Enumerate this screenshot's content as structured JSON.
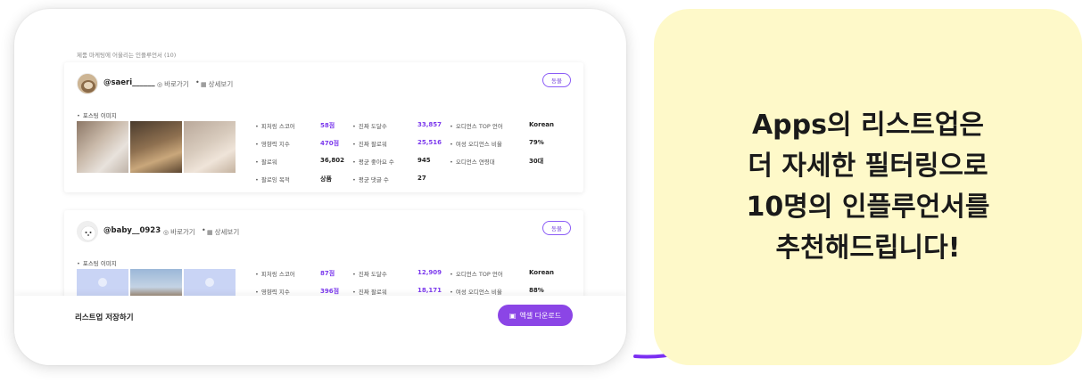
{
  "list": {
    "header": "제품 마케팅에 어울리는 인플루언서 (10)"
  },
  "influencers": [
    {
      "username": "@saeri______",
      "profile_link": "바로가기",
      "detail_link": "상세보기",
      "tag": "동물",
      "posting_label": "포스팅 이미지",
      "metrics": {
        "feature_score": {
          "label": "피처링 스코어",
          "value": "58점"
        },
        "influence_index": {
          "label": "영향력 지수",
          "value": "470점"
        },
        "followers": {
          "label": "팔로워",
          "value": "36,802"
        },
        "follow_purpose": {
          "label": "팔로잉 목적",
          "value": "상품"
        },
        "real_reach": {
          "label": "진짜 도달수",
          "value": "33,857"
        },
        "real_followers": {
          "label": "진짜 팔로워",
          "value": "25,516"
        },
        "avg_likes": {
          "label": "평균 좋아요 수",
          "value": "945"
        },
        "avg_comments": {
          "label": "평균 댓글 수",
          "value": "27"
        },
        "audience_lang": {
          "label": "오디언스 TOP 언어",
          "value": "Korean"
        },
        "female_ratio": {
          "label": "여성 오디언스 비율",
          "value": "79%"
        },
        "age_group": {
          "label": "오디언스 연령대",
          "value": "30대"
        }
      }
    },
    {
      "username": "@baby__0923",
      "profile_link": "바로가기",
      "detail_link": "상세보기",
      "tag": "동물",
      "posting_label": "포스팅 이미지",
      "metrics": {
        "feature_score": {
          "label": "피처링 스코어",
          "value": "87점"
        },
        "influence_index": {
          "label": "영향력 지수",
          "value": "396점"
        },
        "real_reach": {
          "label": "진짜 도달수",
          "value": "12,909"
        },
        "real_followers": {
          "label": "진짜 팔로워",
          "value": "18,171"
        },
        "audience_lang": {
          "label": "오디언스 TOP 언어",
          "value": "Korean"
        },
        "female_ratio": {
          "label": "여성 오디언스 비율",
          "value": "88%"
        }
      }
    }
  ],
  "bottom": {
    "save_label": "리스트업 저장하기",
    "excel_label": "엑셀 다운로드"
  },
  "callout": {
    "lines": [
      "Apps의 리스트업은",
      "더 자세한 필터링으로",
      "10명의 인플루언서를",
      "추천해드립니다!"
    ]
  },
  "colors": {
    "accent": "#8b45e6",
    "value_purple": "#7c3aed",
    "callout_bg": "#fef9c9"
  },
  "icons": {
    "instagram": "instagram-icon",
    "calendar": "calendar-icon",
    "excel": "excel-icon"
  }
}
